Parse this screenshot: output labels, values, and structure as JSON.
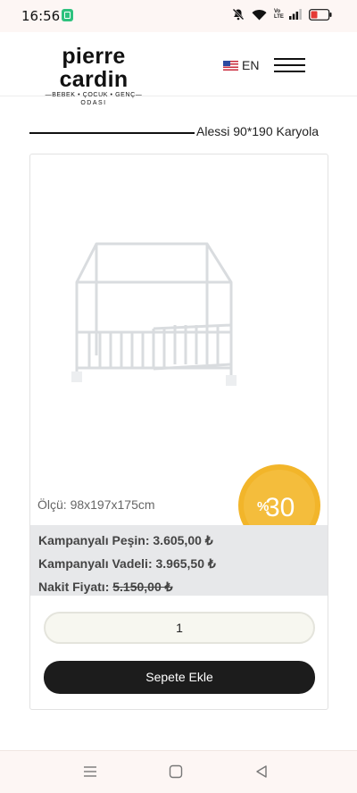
{
  "status_bar": {
    "time": "16:56",
    "icons": [
      "app-notification-icon",
      "mute-icon",
      "wifi-icon",
      "volte-icon",
      "signal-icon",
      "battery-icon"
    ],
    "volte_label": "Vo LTE"
  },
  "header": {
    "brand": "pierre cardin",
    "tagline": "BEBEK • ÇOCUK • GENÇ",
    "tagline2": "ODASI",
    "language": "EN",
    "flag": "us-flag-icon",
    "menu_icon": "hamburger-menu-icon"
  },
  "product": {
    "title": "Alessi 90*190 Karyola",
    "size": "Ölçü: 98x197x175cm",
    "discount": "30",
    "discount_symbol": "%",
    "campaign_cash_label": "Kampanyalı Peşin:",
    "campaign_cash_value": "3.605,00 ₺",
    "campaign_installment_label": "Kampanyalı Vadeli:",
    "campaign_installment_value": "3.965,50 ₺",
    "cash_price_label": "Nakit Fiyatı:",
    "cash_price_value": "5.150,00 ₺",
    "quantity": "1",
    "add_to_cart": "Sepete Ekle"
  },
  "colors": {
    "accent_badge": "#f2b52a",
    "button_dark": "#1c1c1c",
    "price_bg": "#e7e8ea"
  },
  "nav_bar": {
    "icons": [
      "recent-apps-icon",
      "home-icon",
      "back-icon"
    ]
  }
}
